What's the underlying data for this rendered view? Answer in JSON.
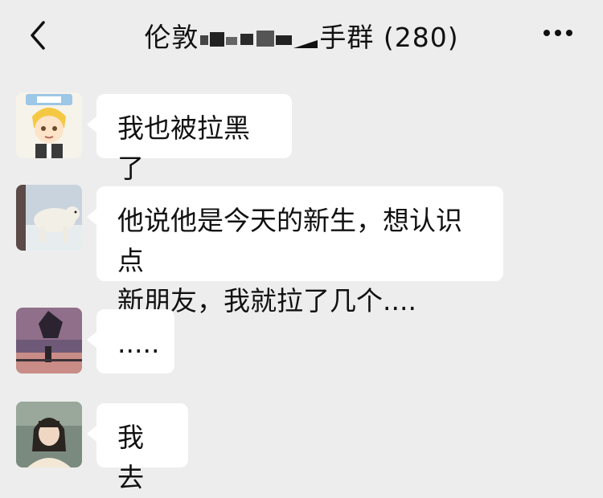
{
  "header": {
    "back_icon": "chevron-left-icon",
    "title_prefix": "伦敦",
    "title_suffix": "手群",
    "member_count": "(280)",
    "more_icon": "more-horizontal-icon"
  },
  "messages": [
    {
      "text": "我也被拉黑了"
    },
    {
      "text_line1": "他说他是今天的新生，想认识点",
      "text_line2": "新朋友，我就拉了几个...."
    },
    {
      "text": "....."
    },
    {
      "text": "我去"
    }
  ],
  "colors": {
    "background": "#ededed",
    "bubble": "#ffffff"
  }
}
